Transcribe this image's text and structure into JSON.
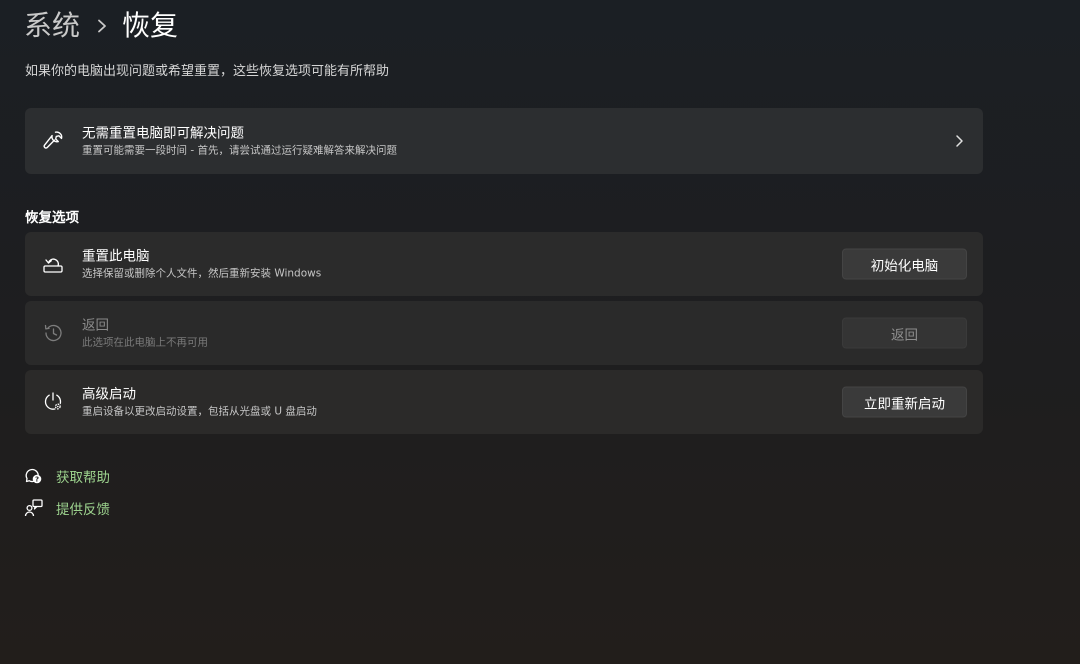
{
  "breadcrumb": {
    "parent": "系统",
    "separator": "›",
    "current": "恢复"
  },
  "page_description": "如果你的电脑出现问题或希望重置，这些恢复选项可能有所帮助",
  "troubleshoot_card": {
    "title": "无需重置电脑即可解决问题",
    "subtitle": "重置可能需要一段时间 - 首先，请尝试通过运行疑难解答来解决问题",
    "icon": "wrench-icon"
  },
  "recovery_section": {
    "title": "恢复选项",
    "items": [
      {
        "title": "重置此电脑",
        "subtitle": "选择保留或删除个人文件，然后重新安装 Windows",
        "button_label": "初始化电脑",
        "icon": "reset-pc-icon",
        "enabled": true
      },
      {
        "title": "返回",
        "subtitle": "此选项在此电脑上不再可用",
        "button_label": "返回",
        "icon": "history-icon",
        "enabled": false
      },
      {
        "title": "高级启动",
        "subtitle": "重启设备以更改启动设置，包括从光盘或 U 盘启动",
        "button_label": "立即重新启动",
        "icon": "advanced-startup-icon",
        "enabled": true
      }
    ]
  },
  "links": {
    "get_help": "获取帮助",
    "give_feedback": "提供反馈"
  },
  "colors": {
    "link_accent": "#9dd38e",
    "card_background": "#2b2b2b",
    "button_background": "#3a3a3a"
  }
}
